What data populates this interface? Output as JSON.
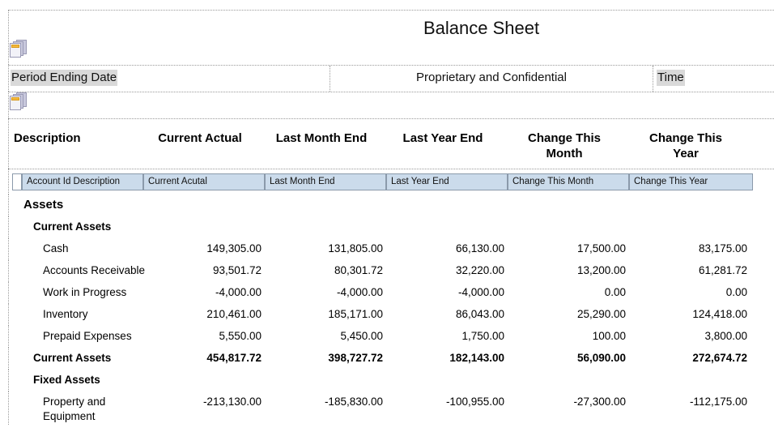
{
  "report": {
    "title": "Balance Sheet"
  },
  "page_header": {
    "period_ending_label": "Period Ending Date",
    "confidential_label": "Proprietary and Confidential",
    "time_label": "Time"
  },
  "column_titles": {
    "description": "Description",
    "current_actual": "Current Actual",
    "last_month_end": "Last Month End",
    "last_year_end": "Last Year End",
    "change_this_month": "Change This\nMonth",
    "change_this_year": "Change This\nYear"
  },
  "field_names": {
    "description": "Account Id Description",
    "current_actual": "Current Acutal",
    "last_month_end": "Last Month End",
    "last_year_end": "Last Year End",
    "change_this_month": "Change This Month",
    "change_this_year": "Change This Year"
  },
  "icons": {
    "top": "stacked-documents-icon",
    "middle": "stacked-documents-icon"
  },
  "colors": {
    "field_name_bg": "#cbdbeb",
    "field_name_border": "#8b9aab",
    "highlight_bg": "#d9d9d9",
    "dotted_border": "#9a9a9a",
    "icon_accent": "#f6b93b"
  },
  "rows": [
    {
      "level": 0,
      "label": "Assets",
      "values": [
        "",
        "",
        "",
        "",
        ""
      ]
    },
    {
      "level": 1,
      "label": "Current Assets",
      "values": [
        "",
        "",
        "",
        "",
        ""
      ]
    },
    {
      "level": 2,
      "label": "Cash",
      "values": [
        "149,305.00",
        "131,805.00",
        "66,130.00",
        "17,500.00",
        "83,175.00"
      ]
    },
    {
      "level": 2,
      "label": "Accounts Receivable",
      "values": [
        "93,501.72",
        "80,301.72",
        "32,220.00",
        "13,200.00",
        "61,281.72"
      ]
    },
    {
      "level": 2,
      "label": "Work in Progress",
      "values": [
        "-4,000.00",
        "-4,000.00",
        "-4,000.00",
        "0.00",
        "0.00"
      ]
    },
    {
      "level": 2,
      "label": "Inventory",
      "values": [
        "210,461.00",
        "185,171.00",
        "86,043.00",
        "25,290.00",
        "124,418.00"
      ]
    },
    {
      "level": 2,
      "label": "Prepaid Expenses",
      "values": [
        "5,550.00",
        "5,450.00",
        "1,750.00",
        "100.00",
        "3,800.00"
      ]
    },
    {
      "level": "total",
      "label": "Current Assets",
      "values": [
        "454,817.72",
        "398,727.72",
        "182,143.00",
        "56,090.00",
        "272,674.72"
      ]
    },
    {
      "level": 1,
      "label": "Fixed Assets",
      "values": [
        "",
        "",
        "",
        "",
        ""
      ]
    },
    {
      "level": 2,
      "tall": true,
      "label": "Property and\nEquipment",
      "values": [
        "-213,130.00",
        "-185,830.00",
        "-100,955.00",
        "-27,300.00",
        "-112,175.00"
      ]
    }
  ]
}
